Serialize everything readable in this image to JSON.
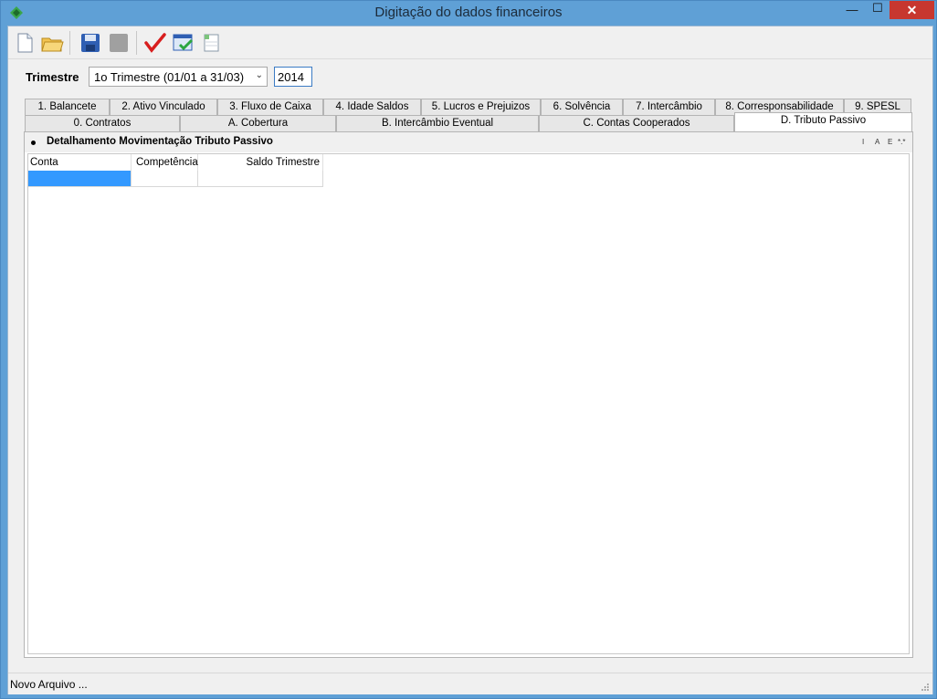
{
  "window": {
    "title": "Digitação do dados financeiros",
    "min": "—",
    "max": "☐",
    "close": "✕"
  },
  "toolbar": {
    "buttons": [
      "new-file-icon",
      "open-folder-icon",
      "save-icon",
      "disabled-icon",
      "checkmark-icon",
      "window-check-icon",
      "sheet-icon"
    ]
  },
  "filter": {
    "label": "Trimestre",
    "quarter": "1o Trimestre (01/01 a 31/03)",
    "arrow": "⌄",
    "year": "2014"
  },
  "tabs_row1": [
    "1. Balancete",
    "2. Ativo Vinculado",
    "3. Fluxo de Caixa",
    "4. Idade Saldos",
    "5. Lucros e Prejuizos",
    "6. Solvência",
    "7. Intercâmbio",
    "8. Corresponsabilidade",
    "9. SPESL"
  ],
  "tabs_row2": [
    "0. Contratos",
    "A. Cobertura",
    "B. Intercâmbio Eventual",
    "C. Contas Cooperados",
    "D. Tributo Passivo"
  ],
  "panel": {
    "title": "Detalhamento Movimentação Tributo Passivo",
    "mini_buttons": [
      "I",
      "A",
      "E",
      "*.*"
    ],
    "columns": [
      "Conta",
      "Competência",
      "Saldo Trimestre"
    ]
  },
  "status": {
    "text": "Novo Arquivo ..."
  }
}
